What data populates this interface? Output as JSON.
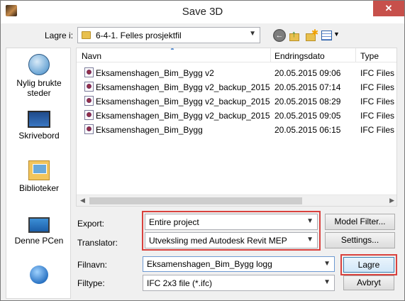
{
  "window": {
    "title": "Save 3D",
    "close_glyph": "✕"
  },
  "location": {
    "label": "Lagre i:",
    "folder": "6-4-1. Felles prosjektfil",
    "icons": [
      "back-icon",
      "up-folder-icon",
      "new-folder-icon",
      "view-menu-icon"
    ]
  },
  "places": [
    {
      "label": "Nylig brukte steder",
      "icon": "recent-places-icon"
    },
    {
      "label": "Skrivebord",
      "icon": "desktop-icon"
    },
    {
      "label": "Biblioteker",
      "icon": "libraries-icon"
    },
    {
      "label": "Denne PCen",
      "icon": "this-pc-icon"
    },
    {
      "label": "",
      "icon": "network-icon"
    }
  ],
  "file_list": {
    "columns": [
      "Navn",
      "Endringsdato",
      "Type"
    ],
    "rows": [
      {
        "name": "Eksamenshagen_Bim_Bygg v2",
        "date": "20.05.2015 09:06",
        "type": "IFC Files"
      },
      {
        "name": "Eksamenshagen_Bim_Bygg v2_backup_2015...",
        "date": "20.05.2015 07:14",
        "type": "IFC Files"
      },
      {
        "name": "Eksamenshagen_Bim_Bygg v2_backup_2015...",
        "date": "20.05.2015 08:29",
        "type": "IFC Files"
      },
      {
        "name": "Eksamenshagen_Bim_Bygg v2_backup_2015...",
        "date": "20.05.2015 09:05",
        "type": "IFC Files"
      },
      {
        "name": "Eksamenshagen_Bim_Bygg",
        "date": "20.05.2015 06:15",
        "type": "IFC Files"
      }
    ]
  },
  "export": {
    "label": "Export:",
    "value": "Entire project",
    "button": "Model Filter..."
  },
  "translator": {
    "label": "Translator:",
    "value": "Utveksling med Autodesk Revit MEP",
    "button": "Settings..."
  },
  "filename": {
    "label": "Filnavn:",
    "value": "Eksamenshagen_Bim_Bygg logg"
  },
  "filetype": {
    "label": "Filtype:",
    "value": "IFC 2x3 file (*.ifc)"
  },
  "actions": {
    "save": "Lagre",
    "cancel": "Avbryt"
  },
  "colors": {
    "highlight": "#d9413d",
    "close": "#c7504b",
    "accent": "#3c7fb1"
  }
}
